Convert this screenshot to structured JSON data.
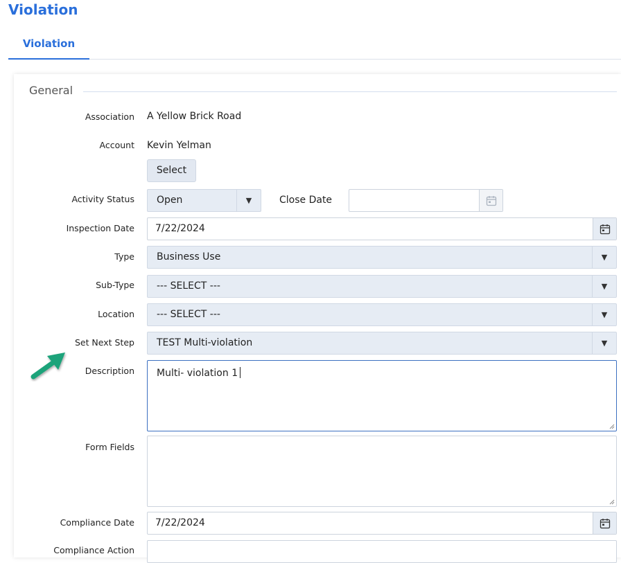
{
  "page": {
    "title": "Violation"
  },
  "tabs": [
    {
      "label": "Violation",
      "active": true
    }
  ],
  "section": {
    "legend": "General"
  },
  "fields": {
    "association": {
      "label": "Association",
      "value": "A Yellow Brick Road"
    },
    "account": {
      "label": "Account",
      "value": "Kevin Yelman",
      "button_label": "Select"
    },
    "activity_status": {
      "label": "Activity Status",
      "value": "Open"
    },
    "close_date": {
      "label": "Close Date",
      "value": ""
    },
    "inspection_date": {
      "label": "Inspection Date",
      "value": "7/22/2024"
    },
    "type": {
      "label": "Type",
      "value": "Business Use"
    },
    "sub_type": {
      "label": "Sub-Type",
      "value": "--- SELECT ---"
    },
    "location": {
      "label": "Location",
      "value": "--- SELECT ---"
    },
    "set_next_step": {
      "label": "Set Next Step",
      "value": "TEST Multi-violation"
    },
    "description": {
      "label": "Description",
      "value": "Multi- violation 1"
    },
    "form_fields": {
      "label": "Form Fields",
      "value": ""
    },
    "compliance_date": {
      "label": "Compliance Date",
      "value": "7/22/2024"
    },
    "compliance_action": {
      "label": "Compliance Action"
    }
  },
  "icons": {
    "dropdown": "caret-down-icon",
    "calendar": "calendar-icon",
    "annotation": "green-arrow-icon"
  },
  "colors": {
    "accent": "#2a6fdb",
    "select_bg": "#e6ecf4",
    "annotation_arrow": "#1aa37a"
  }
}
